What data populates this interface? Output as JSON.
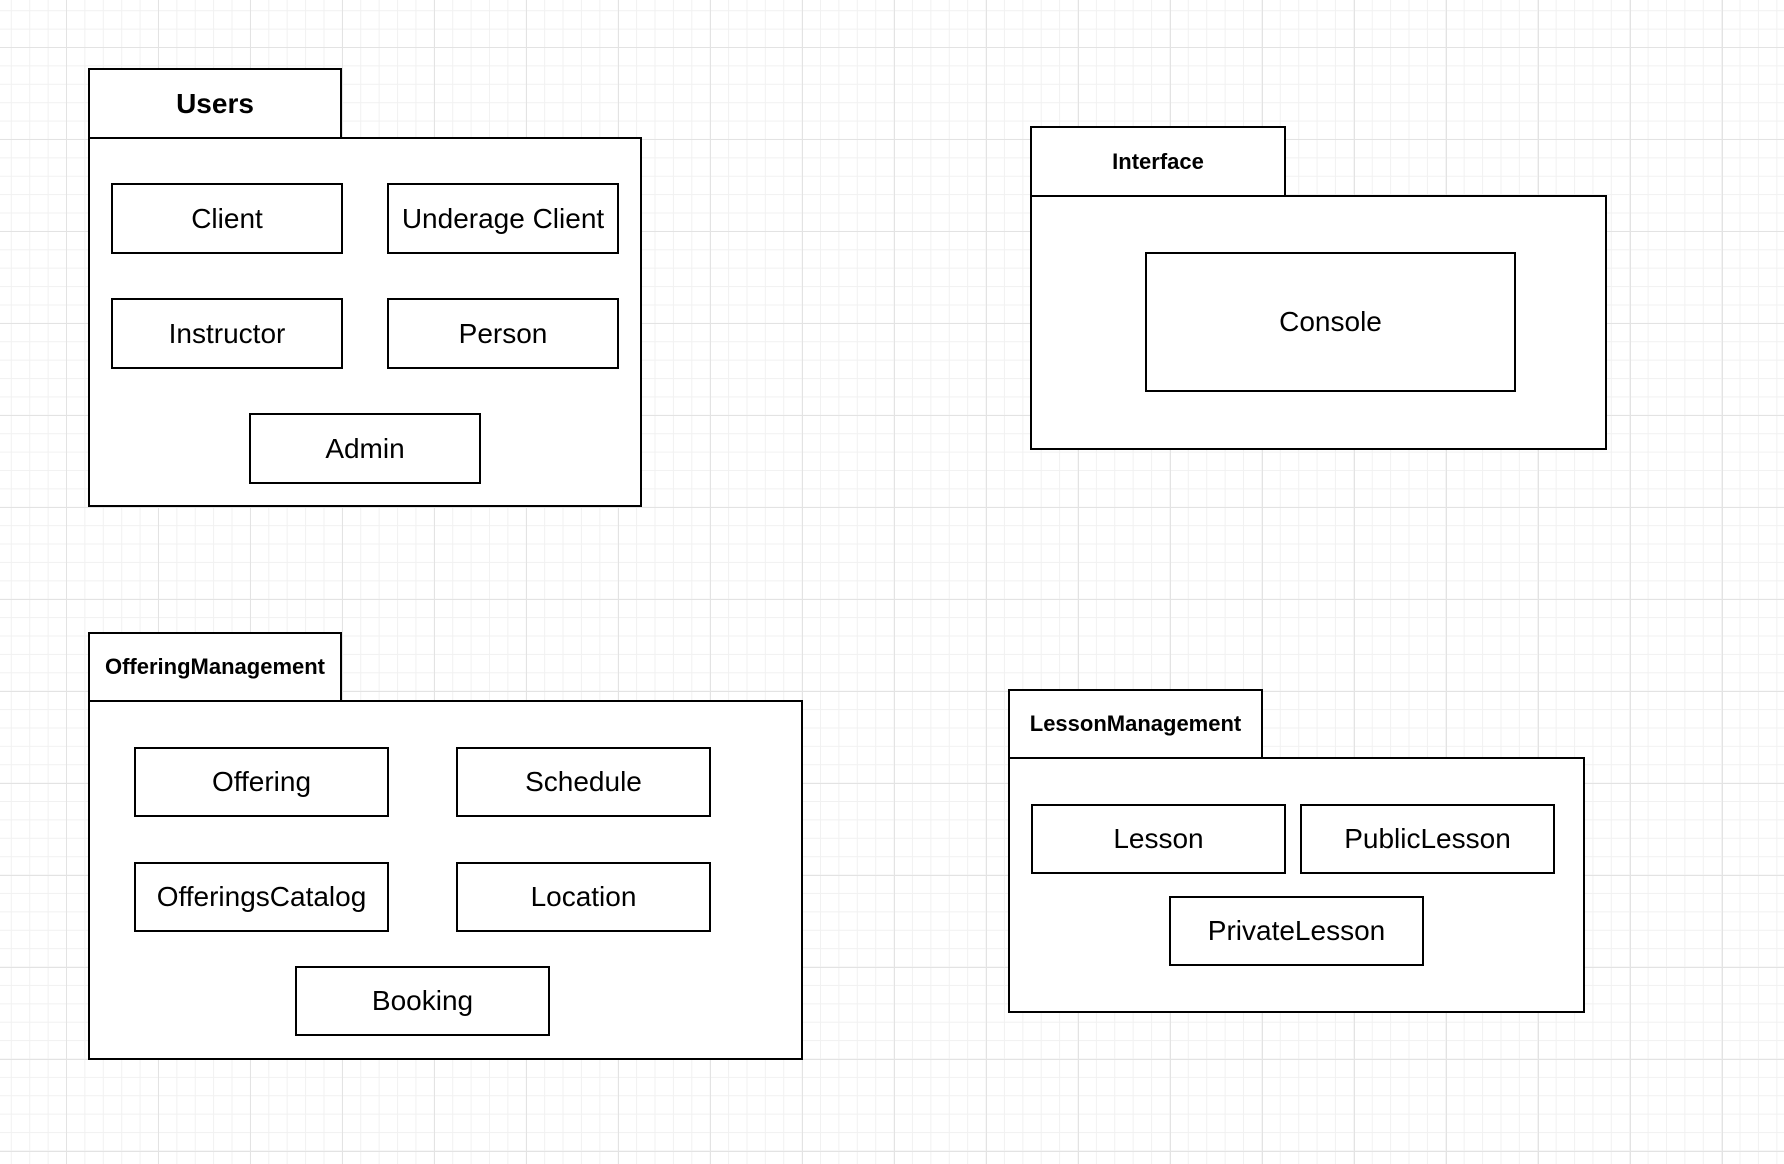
{
  "diagram": {
    "packages": {
      "users": {
        "title": "Users",
        "classes": [
          "Client",
          "Underage Client",
          "Instructor",
          "Person",
          "Admin"
        ]
      },
      "interface": {
        "title": "Interface",
        "classes": [
          "Console"
        ]
      },
      "offering_management": {
        "title": "OfferingManagement",
        "classes": [
          "Offering",
          "Schedule",
          "OfferingsCatalog",
          "Location",
          "Booking"
        ]
      },
      "lesson_management": {
        "title": "LessonManagement",
        "classes": [
          "Lesson",
          "PublicLesson",
          "PrivateLesson"
        ]
      }
    }
  },
  "colors": {
    "line": "#000000",
    "fill": "#ffffff",
    "grid": "#e3e3e3"
  }
}
